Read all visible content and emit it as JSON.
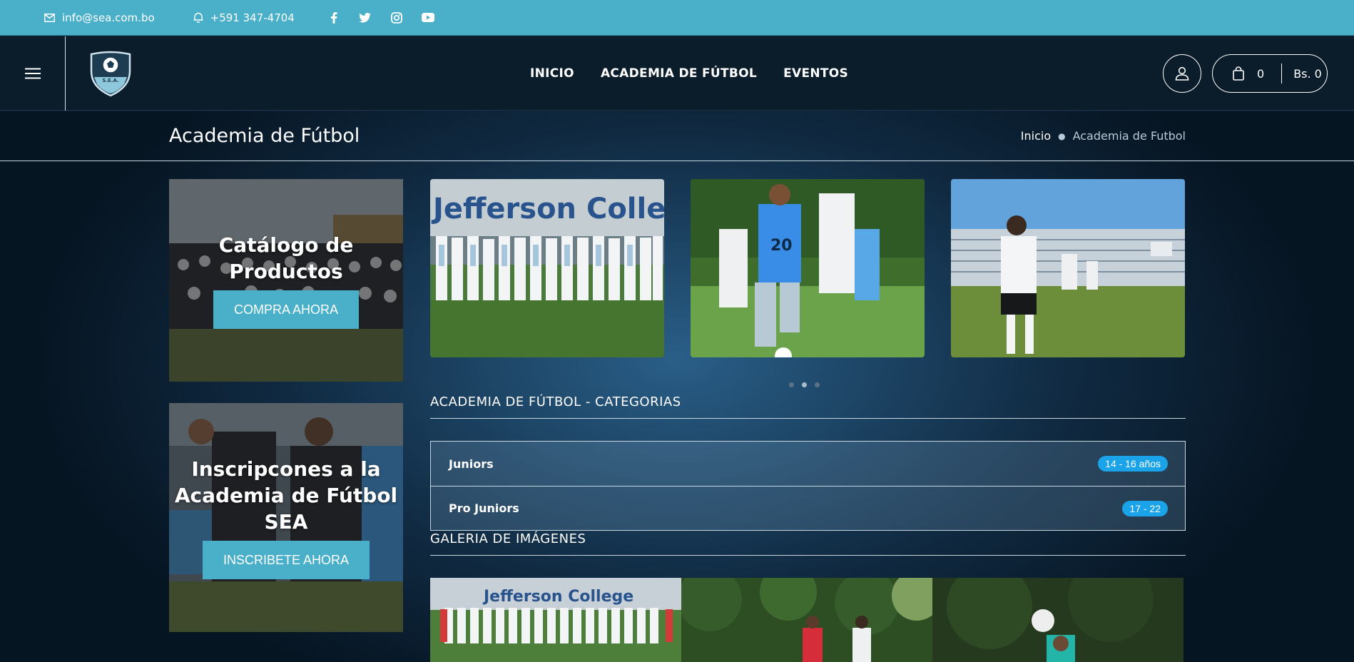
{
  "topbar": {
    "email": "info@sea.com.bo",
    "phone": "+591 347-4704",
    "social": [
      "facebook-icon",
      "twitter-icon",
      "instagram-icon",
      "youtube-icon"
    ]
  },
  "header": {
    "nav": [
      "INICIO",
      "ACADEMIA DE FÚTBOL",
      "EVENTOS"
    ],
    "cart_count": "0",
    "cart_total": "Bs. 0"
  },
  "page": {
    "title": "Academia de Fútbol",
    "breadcrumb": {
      "home": "Inicio",
      "current": "Academia de Futbol"
    }
  },
  "promos": [
    {
      "title_line1": "Catálogo de",
      "title_line2": "Productos",
      "button": "COMPRA AHORA"
    },
    {
      "title_line1": "Inscripcones a la",
      "title_line2": "Academia de Fútbol",
      "title_line3": "SEA",
      "button": "INSCRIBETE AHORA"
    }
  ],
  "slider": {
    "dots": 3,
    "active_dot": 2
  },
  "slide_banner_text": "Jefferson Colle",
  "categories": {
    "title": "ACADEMIA DE FÚTBOL - CATEGORIAS",
    "rows": [
      {
        "name": "Juniors",
        "badge": "14 - 16 años"
      },
      {
        "name": "Pro Juniors",
        "badge": "17 - 22"
      }
    ]
  },
  "gallery": {
    "title": "GALERIA DE IMÁGENES",
    "banner_text": "Jefferson College"
  },
  "colors": {
    "accent": "#4aafc8",
    "badge": "#1aa3e8",
    "header": "#0b1c2b"
  }
}
